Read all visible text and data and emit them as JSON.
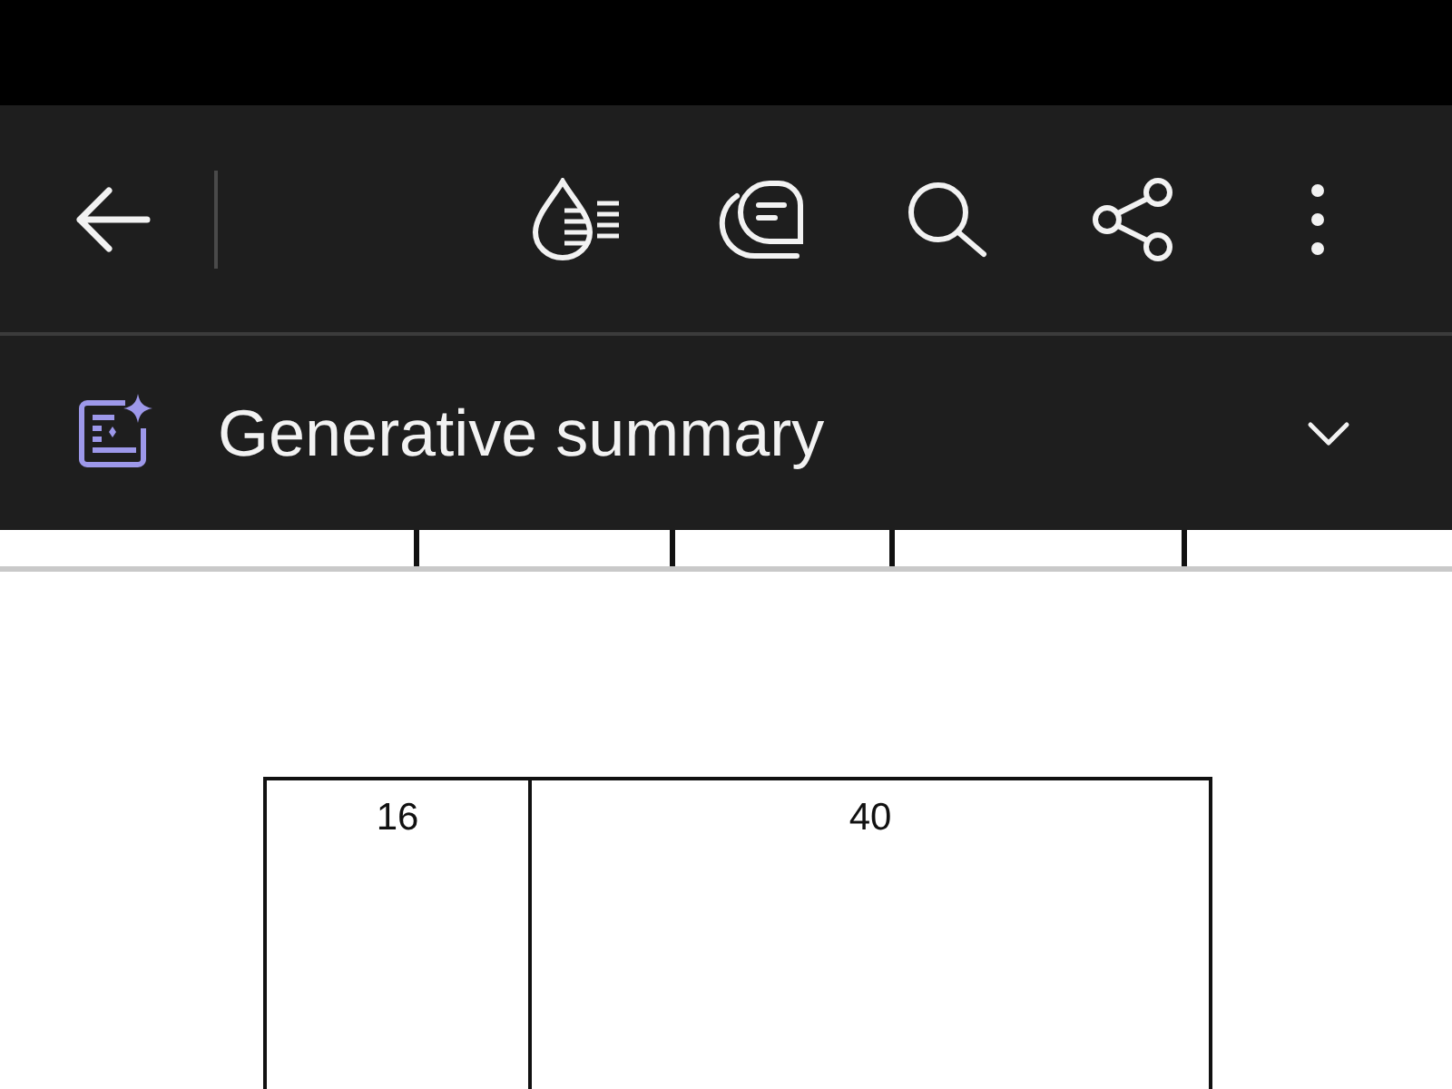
{
  "summary_bar": {
    "title": "Generative summary",
    "expanded": false
  },
  "document": {
    "table": {
      "rows": [
        [
          "16",
          "40"
        ]
      ]
    }
  }
}
